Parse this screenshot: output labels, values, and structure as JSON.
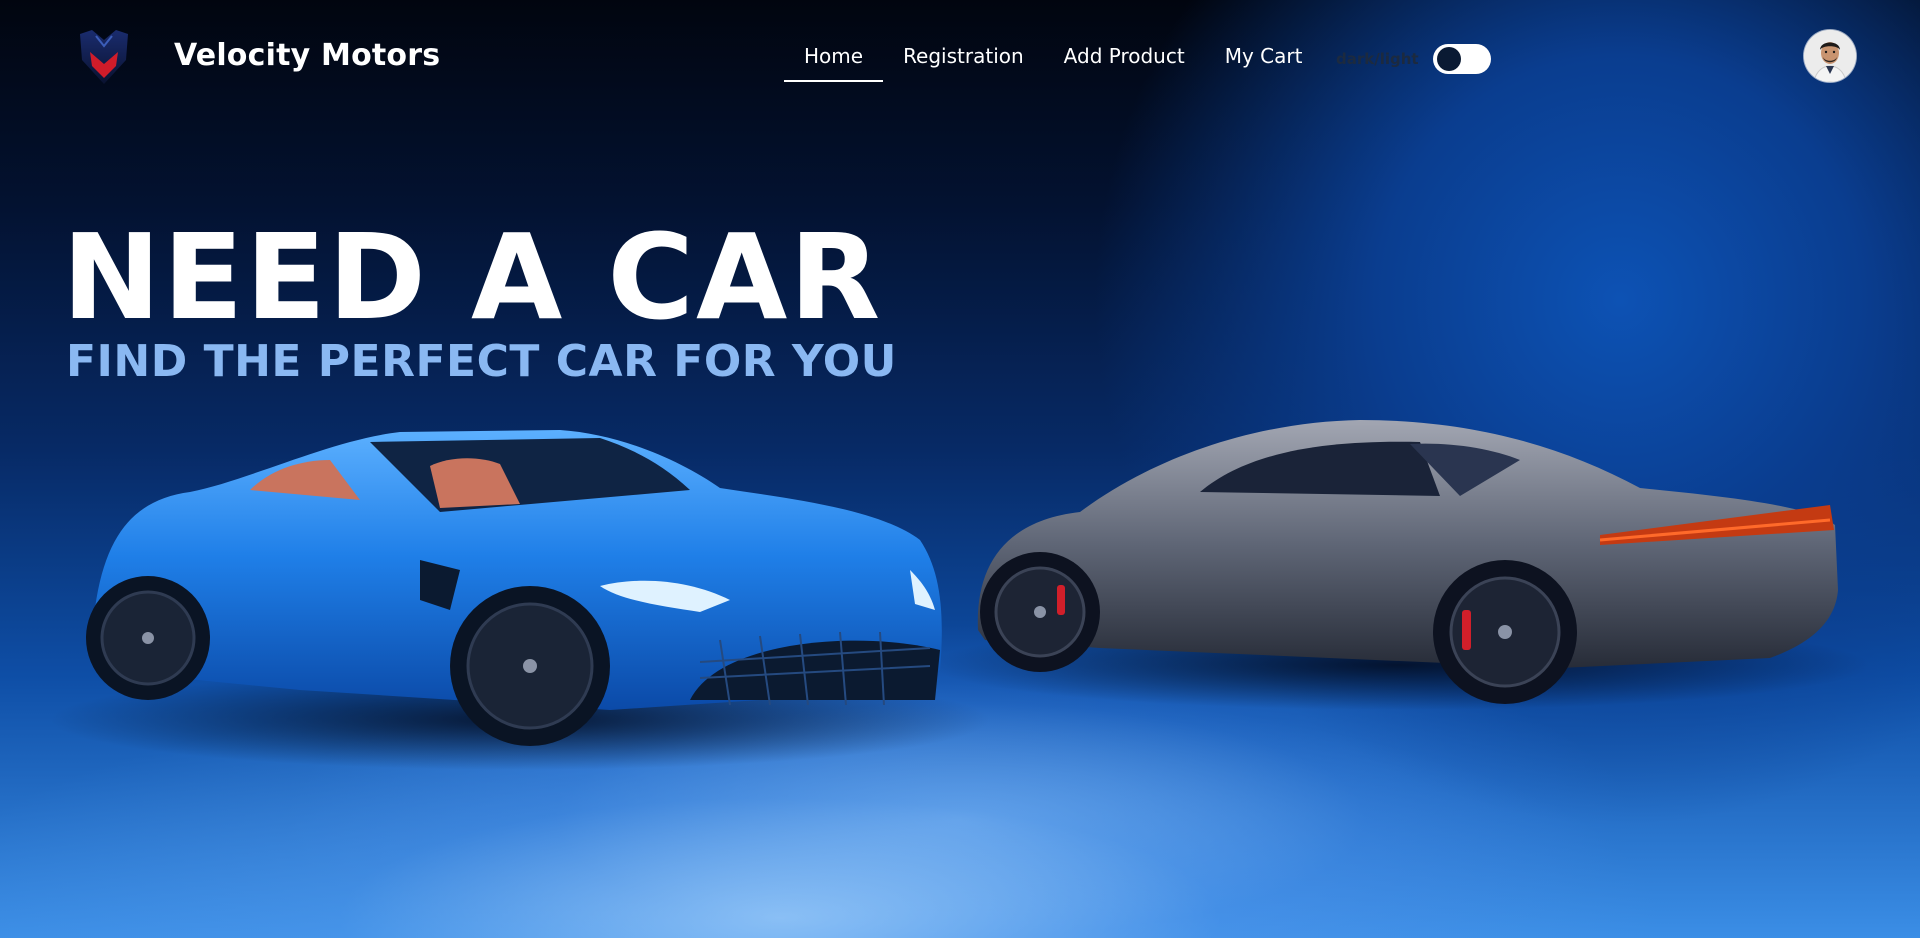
{
  "header": {
    "brand": "Velocity Motors",
    "logo_icon": "velocity-shield-logo"
  },
  "nav": {
    "items": [
      {
        "label": "Home",
        "active": true
      },
      {
        "label": "Registration",
        "active": false
      },
      {
        "label": "Add Product",
        "active": false
      },
      {
        "label": "My Cart",
        "active": false
      }
    ]
  },
  "theme_toggle": {
    "label": "dark/light",
    "state": "off"
  },
  "profile": {
    "avatar_icon": "user-avatar"
  },
  "hero": {
    "title": "NEED A CAR",
    "subtitle": "FIND THE PERFECT CAR FOR YOU",
    "image": "two-sports-cars-blue-and-grey"
  },
  "colors": {
    "accent": "#8ab8f2",
    "background_dark": "#01050f",
    "background_blue": "#0e4ea6",
    "logo_red": "#d01c2a",
    "car_blue": "#1f7fe8",
    "car_grey": "#5f6676"
  }
}
